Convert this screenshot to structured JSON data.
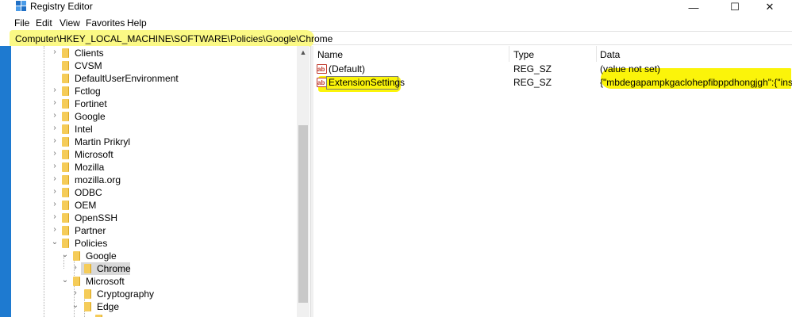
{
  "window": {
    "title": "Registry Editor",
    "minimize": "—",
    "maximize": "☐",
    "close": "✕",
    "icon": "registry-editor-icon"
  },
  "menu": [
    "File",
    "Edit",
    "View",
    "Favorites",
    "Help"
  ],
  "address": "Computer\\HKEY_LOCAL_MACHINE\\SOFTWARE\\Policies\\Google\\Chrome",
  "tree": {
    "items": [
      {
        "label": "Clients",
        "expander": "›"
      },
      {
        "label": "CVSM",
        "expander": ""
      },
      {
        "label": "DefaultUserEnvironment",
        "expander": ""
      },
      {
        "label": "Fctlog",
        "expander": "›"
      },
      {
        "label": "Fortinet",
        "expander": "›"
      },
      {
        "label": "Google",
        "expander": "›"
      },
      {
        "label": "Intel",
        "expander": "›"
      },
      {
        "label": "Martin Prikryl",
        "expander": "›"
      },
      {
        "label": "Microsoft",
        "expander": "›"
      },
      {
        "label": "Mozilla",
        "expander": "›"
      },
      {
        "label": "mozilla.org",
        "expander": "›"
      },
      {
        "label": "ODBC",
        "expander": "›"
      },
      {
        "label": "OEM",
        "expander": "›"
      },
      {
        "label": "OpenSSH",
        "expander": "›"
      },
      {
        "label": "Partner",
        "expander": "›"
      },
      {
        "label": "Policies",
        "expander": "⌄"
      },
      {
        "label": "Google",
        "expander": "⌄"
      },
      {
        "label": "Chrome",
        "expander": "›"
      },
      {
        "label": "Microsoft",
        "expander": "⌄"
      },
      {
        "label": "Cryptography",
        "expander": "›"
      },
      {
        "label": "Edge",
        "expander": "⌄"
      }
    ]
  },
  "list": {
    "columns": [
      "Name",
      "Type",
      "Data"
    ],
    "rows": [
      {
        "icon": "ab",
        "name": "(Default)",
        "type": "REG_SZ",
        "data": "(value not set)"
      },
      {
        "icon": "ab",
        "name": "ExtensionSettings",
        "type": "REG_SZ",
        "data": "{\"mbdegapampkgaclohepfibppdhongjgh\":{\"ins"
      }
    ]
  }
}
